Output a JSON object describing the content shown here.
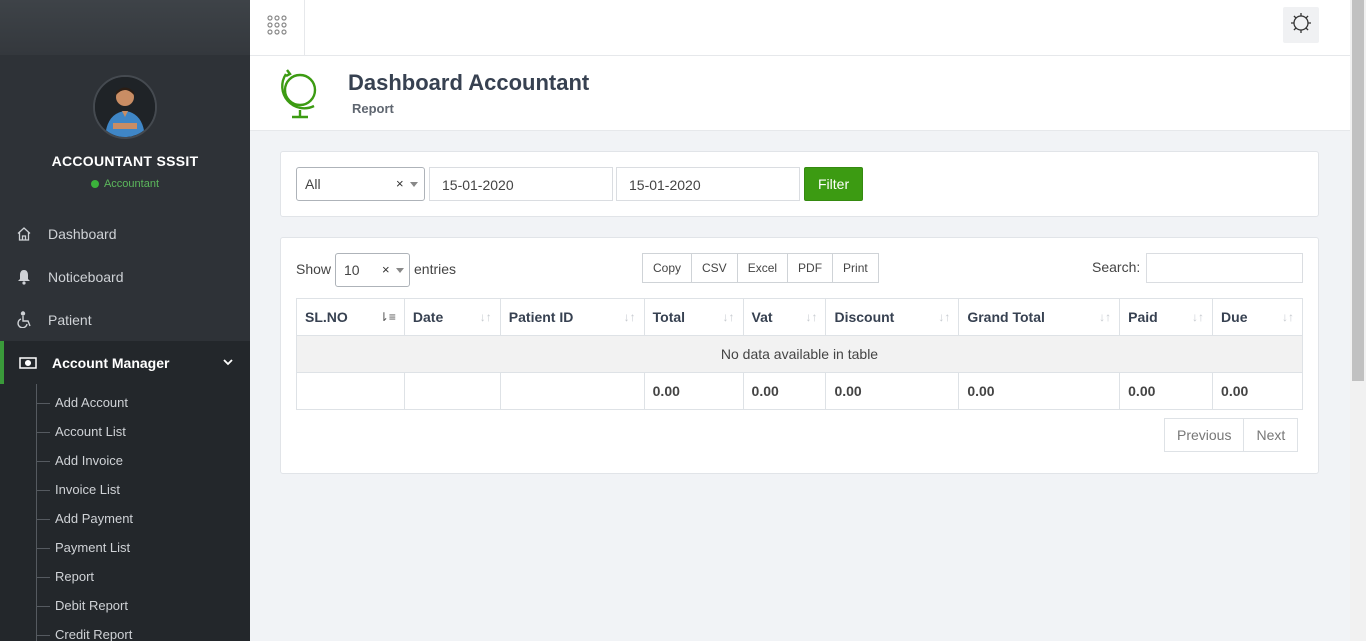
{
  "user": {
    "name": "ACCOUNTANT SSSIT",
    "role": "Accountant"
  },
  "nav": {
    "dashboard": "Dashboard",
    "noticeboard": "Noticeboard",
    "patient": "Patient",
    "account_manager": "Account Manager"
  },
  "submenu": [
    "Add Account",
    "Account List",
    "Add Invoice",
    "Invoice List",
    "Add Payment",
    "Payment List",
    "Report",
    "Debit Report",
    "Credit Report"
  ],
  "header": {
    "title": "Dashboard Accountant",
    "subtitle": "Report"
  },
  "filter": {
    "select_value": "All",
    "clear": "×",
    "date_from": "15-01-2020",
    "date_to": "15-01-2020",
    "button": "Filter"
  },
  "table_controls": {
    "show": "Show",
    "length": "10",
    "clear": "×",
    "entries": "entries",
    "search_label": "Search:",
    "search_value": "",
    "export": [
      "Copy",
      "CSV",
      "Excel",
      "PDF",
      "Print"
    ]
  },
  "table": {
    "columns": [
      "SL.NO",
      "Date",
      "Patient ID",
      "Total",
      "Vat",
      "Discount",
      "Grand Total",
      "Paid",
      "Due"
    ],
    "empty": "No data available in table",
    "footer": [
      "",
      "",
      "",
      "0.00",
      "0.00",
      "0.00",
      "0.00",
      "0.00",
      "0.00"
    ]
  },
  "pager": {
    "previous": "Previous",
    "next": "Next"
  },
  "colors": {
    "accent": "#3c9b12",
    "sidebar": "#2e3237",
    "active_border": "#3a9a3a"
  }
}
